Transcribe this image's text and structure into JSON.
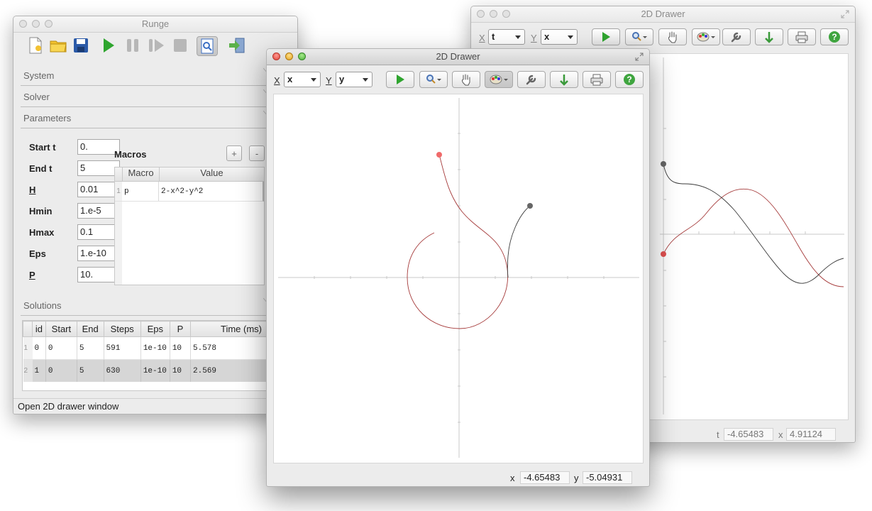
{
  "runge": {
    "title": "Runge",
    "sections": {
      "system": "System",
      "solver": "Solver",
      "parameters": "Parameters",
      "solutions": "Solutions"
    },
    "params": [
      {
        "label": "Start t",
        "value": "0."
      },
      {
        "label": "End t",
        "value": "5"
      },
      {
        "label": "H",
        "value": "0.01"
      },
      {
        "label": "Hmin",
        "value": "1.e-5"
      },
      {
        "label": "Hmax",
        "value": "0.1"
      },
      {
        "label": "Eps",
        "value": "1.e-10"
      },
      {
        "label": "P",
        "value": "10."
      }
    ],
    "macros": {
      "title": "Macros",
      "add_label": "+",
      "remove_label": "-",
      "columns": [
        "Macro",
        "Value"
      ],
      "rows": [
        {
          "num": "1",
          "macro": "p",
          "value": "2-x^2-y^2"
        }
      ]
    },
    "solutions_table": {
      "columns": [
        "id",
        "Start",
        "End",
        "Steps",
        "Eps",
        "P",
        "Time (ms)"
      ],
      "rows": [
        {
          "num": "1",
          "id": "0",
          "start": "0",
          "end": "5",
          "steps": "591",
          "eps": "1e-10",
          "p": "10",
          "time": "5.578"
        },
        {
          "num": "2",
          "id": "1",
          "start": "0",
          "end": "5",
          "steps": "630",
          "eps": "1e-10",
          "p": "10",
          "time": "2.569"
        }
      ]
    },
    "status_text": "Open 2D drawer window"
  },
  "drawer_back": {
    "title": "2D Drawer",
    "x_label": "X",
    "x_value": "t",
    "y_label": "Y",
    "y_value": "x",
    "coord_x_label": "t",
    "coord_x_value": "-4.65483",
    "coord_y_label": "x",
    "coord_y_value": "4.91124"
  },
  "drawer_front": {
    "title": "2D Drawer",
    "x_label": "X",
    "x_value": "x",
    "y_label": "Y",
    "y_value": "y",
    "coord_x_label": "x",
    "coord_x_value": "-4.65483",
    "coord_y_label": "y",
    "coord_y_value": "-5.04931"
  },
  "colors": {
    "trajectory_red": "#a53a3a",
    "trajectory_gray": "#3a3a3a",
    "start_red": "#f06a6a",
    "start_gray": "#666666",
    "run_green": "#2fa52f"
  },
  "icons": [
    "new-file-icon",
    "open-folder-icon",
    "save-disk-icon",
    "play-icon",
    "pause-icon",
    "step-icon",
    "stop-icon",
    "preview-icon",
    "export-icon",
    "zoom-icon",
    "hand-icon",
    "color-palette-icon",
    "wrench-icon",
    "download-icon",
    "print-icon",
    "help-icon"
  ]
}
